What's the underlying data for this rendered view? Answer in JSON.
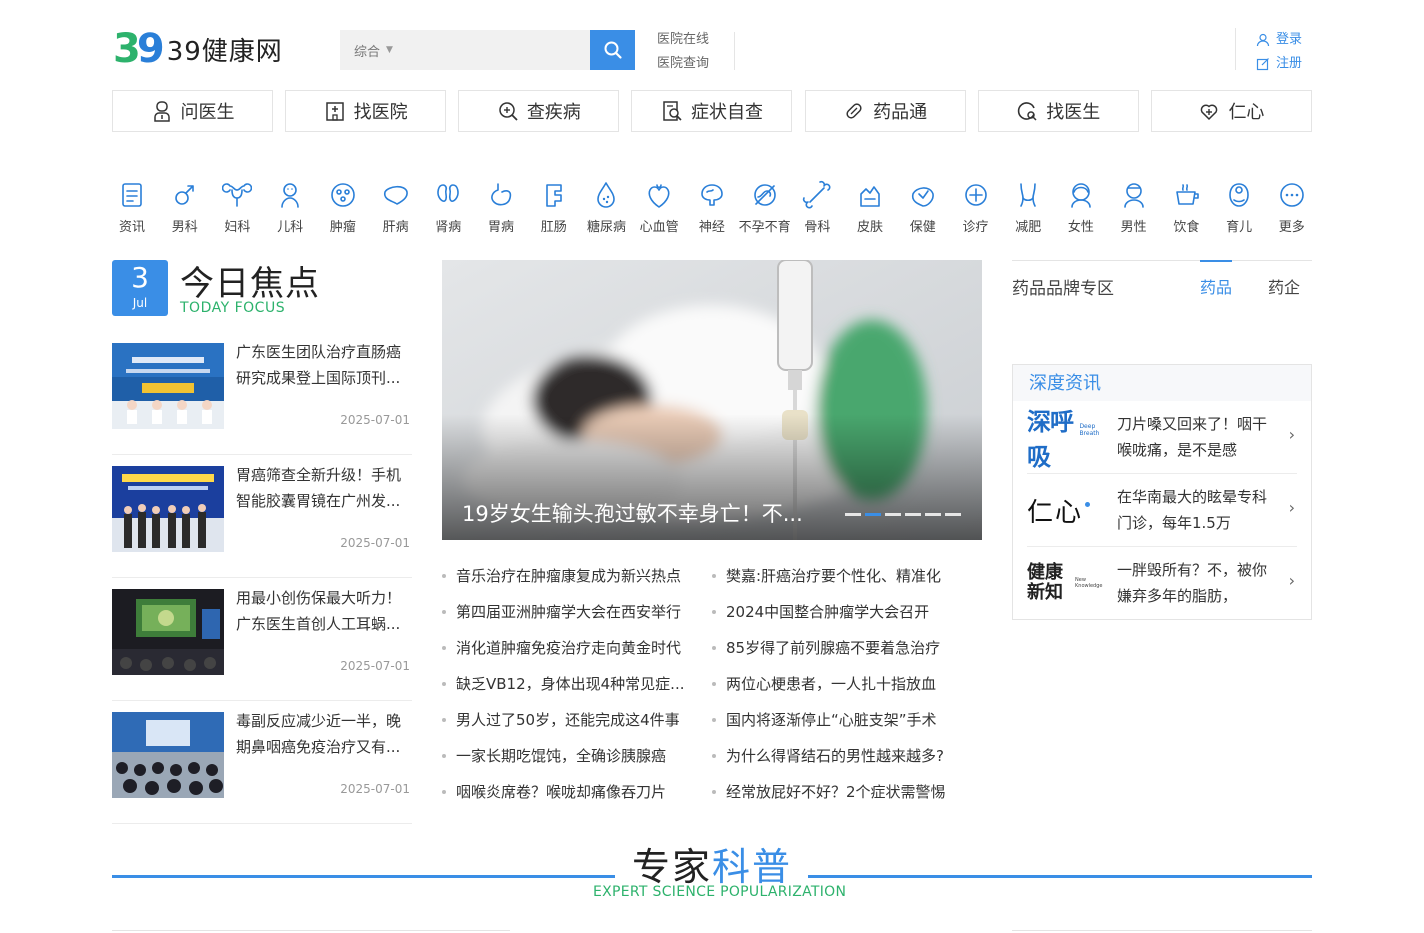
{
  "header": {
    "logo_number": "39",
    "logo_text": "39健康网",
    "search_category": "综合",
    "search_placeholder": "",
    "links": [
      "医院在线",
      "医院查询"
    ],
    "login": "登录",
    "register": "注册"
  },
  "nav": [
    {
      "label": "问医生",
      "icon": "doctor-icon"
    },
    {
      "label": "找医院",
      "icon": "hospital-icon"
    },
    {
      "label": "查疾病",
      "icon": "search-disease-icon"
    },
    {
      "label": "症状自查",
      "icon": "symptom-check-icon"
    },
    {
      "label": "药品通",
      "icon": "pill-icon"
    },
    {
      "label": "找医生",
      "icon": "find-doctor-icon"
    },
    {
      "label": "仁心",
      "icon": "heart-add-icon"
    }
  ],
  "categories": [
    "资讯",
    "男科",
    "妇科",
    "儿科",
    "肿瘤",
    "肝病",
    "肾病",
    "胃病",
    "肛肠",
    "糖尿病",
    "心血管",
    "神经",
    "不孕不育",
    "骨科",
    "皮肤",
    "保健",
    "诊疗",
    "减肥",
    "女性",
    "男性",
    "饮食",
    "育儿",
    "更多"
  ],
  "today_focus": {
    "day": "3",
    "month": "Jul",
    "title": "今日焦点",
    "subtitle": "TODAY FOCUS",
    "items": [
      {
        "title": "广东医生团队治疗直肠癌研究成果登上国际顶刊...",
        "date": "2025-07-01"
      },
      {
        "title": "胃癌筛查全新升级！手机智能胶囊胃镜在广州发...",
        "date": "2025-07-01"
      },
      {
        "title": "用最小创伤保最大听力！广东医生首创人工耳蜗...",
        "date": "2025-07-01"
      },
      {
        "title": "毒副反应减少近一半，晚期鼻咽癌免疫治疗又有...",
        "date": "2025-07-01"
      }
    ]
  },
  "hero": {
    "caption": "19岁女生输头孢过敏不幸身亡！不...",
    "slide_count": 6,
    "active_slide": 2
  },
  "headlines_left": [
    "音乐治疗在肿瘤康复成为新兴热点",
    "第四届亚洲肿瘤学大会在西安举行",
    "消化道肿瘤免疫治疗走向黄金时代",
    "缺乏VB12，身体出现4种常见症...",
    "男人过了50岁，还能完成这4件事",
    "一家长期吃馄饨，全确诊胰腺癌",
    "咽喉炎席卷？喉咙却痛像吞刀片"
  ],
  "headlines_right": [
    "樊嘉:肝癌治疗要个性化、精准化",
    "2024中国整合肿瘤学大会召开",
    "85岁得了前列腺癌不要着急治疗",
    "两位心梗患者，一人扎十指放血",
    "国内将逐渐停止“心脏支架”手术",
    "为什么得肾结石的男性越来越多?",
    "经常放屁好不好？2个症状需警惕"
  ],
  "brand_zone": {
    "title": "药品品牌专区",
    "tabs": [
      "药品",
      "药企"
    ],
    "active_tab": "药品"
  },
  "deep_news": {
    "title": "深度资讯",
    "items": [
      {
        "logo": "深呼吸",
        "logo_sub": "Deep Breath",
        "text": "刀片嗓又回来了！咽干喉咙痛，是不是感"
      },
      {
        "logo": "仁心",
        "logo_sub": "",
        "text": "在华南最大的眩晕专科门诊，每年1.5万"
      },
      {
        "logo": "健康新知",
        "logo_sub": "New Knowledge",
        "text": "一胖毁所有？不，被你嫌弃多年的脂肪，"
      }
    ]
  },
  "expert": {
    "title_a": "专家",
    "title_b": "科普",
    "subtitle": "EXPERT SCIENCE POPULARIZATION"
  },
  "colors": {
    "accent": "#3a8ee6",
    "green": "#2db26c"
  }
}
